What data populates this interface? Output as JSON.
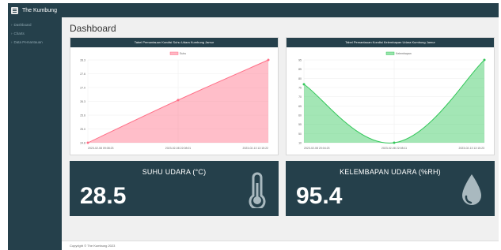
{
  "app": {
    "brand": "The Kumbung"
  },
  "sidebar": {
    "items": [
      {
        "label": "Dashboard"
      },
      {
        "label": "Charts"
      },
      {
        "label": "Data Pemantauan"
      }
    ]
  },
  "main": {
    "page_title": "Dashboard"
  },
  "charts": {
    "left_title": "Tabel Pemantauan Kondisi Suhu Udara Kumbung Jamur",
    "right_title": "Tabel Pemantauan Kondisi Kelembapan Udara Kumbung Jamur"
  },
  "chart_data": [
    {
      "type": "area",
      "title": "Tabel Pemantauan Kondisi Suhu Udara Kumbung Jamur",
      "legend_position": "top",
      "x": [
        "2023-02-08 09:08:23",
        "2023-02-08 22:08:01",
        "2023-02-13 12:15:22"
      ],
      "series": [
        {
          "name": "Suhu",
          "values": [
            25.0,
            26.7,
            28.3
          ],
          "color": "#ff6f87"
        }
      ],
      "ylim": [
        25.0,
        28.3
      ],
      "yticks": [
        "28.3",
        "27.6",
        "27.0",
        "26.3",
        "25.6",
        "25.0",
        "24.8"
      ],
      "grid": true
    },
    {
      "type": "area",
      "title": "Tabel Pemantauan Kondisi Kelembapan Udara Kumbung Jamur",
      "legend_position": "top",
      "x": [
        "2023-02-08 20:04:23",
        "2023-02-08 22:08:11",
        "2023-02-13 12:15:23"
      ],
      "series": [
        {
          "name": "Kelembapan",
          "values": [
            70,
            10,
            95
          ],
          "color": "#34c75a"
        }
      ],
      "ylim": [
        10,
        95
      ],
      "yticks": [
        "95",
        "85",
        "80",
        "75",
        "70",
        "65",
        "60",
        "55",
        "50",
        "10"
      ],
      "grid": true
    }
  ],
  "stats": {
    "temp": {
      "label": "SUHU UDARA (°C)",
      "value": "28.5",
      "icon": "thermometer-icon"
    },
    "humid": {
      "label": "KELEMBAPAN UDARA (%RH)",
      "value": "95.4",
      "icon": "droplet-icon"
    }
  },
  "footer": {
    "text": "Copyright © The Kumbung 2023"
  },
  "colors": {
    "dark": "#25404b",
    "temp": "#ff6f87",
    "humid": "#34c75a"
  }
}
